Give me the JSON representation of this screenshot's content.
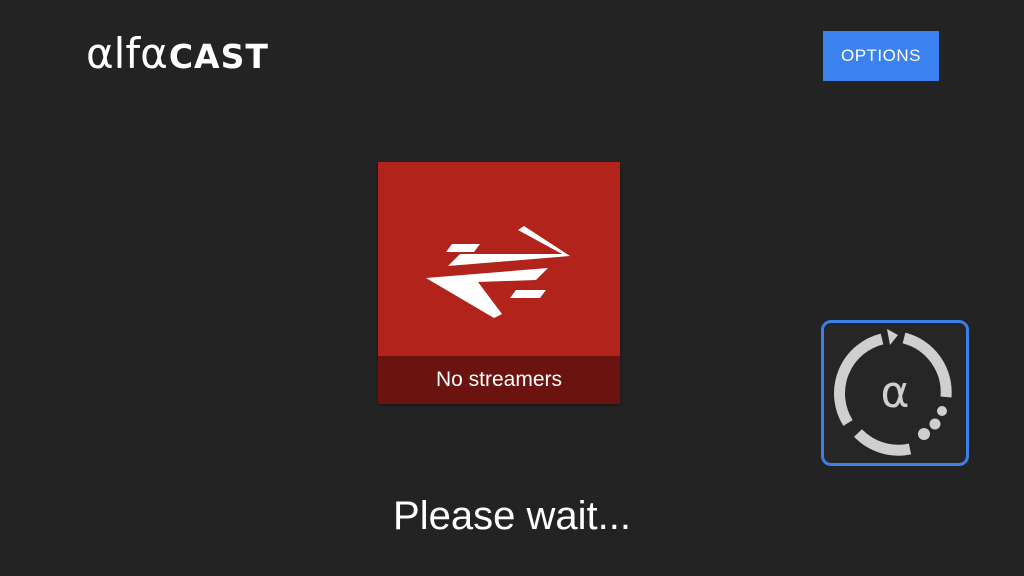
{
  "header": {
    "logo_alfa": "αlfα",
    "logo_cast": "CAST",
    "options_label": "OPTIONS"
  },
  "stream_card": {
    "icon": "swap-arrows-icon",
    "label": "No streamers"
  },
  "loader": {
    "icon": "alfacast-loading-spinner-icon",
    "symbol": "α"
  },
  "status": {
    "message": "Please wait..."
  },
  "colors": {
    "background": "#232323",
    "accent": "#3b82f0",
    "card": "#b1231b",
    "card_footer": "#6b130f"
  }
}
